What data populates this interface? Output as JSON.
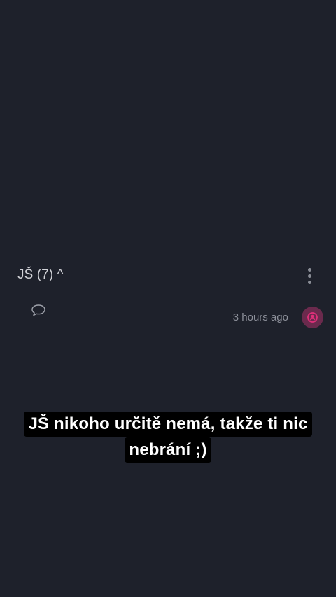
{
  "post": {
    "title": "JŠ (7) ^",
    "timestamp": "3 hours ago",
    "more_icon": "more-vertical-icon",
    "comment_icon": "comment-bubble-icon",
    "avatar_icon": "user-avatar-icon"
  },
  "caption": {
    "lines": [
      "JŠ nikoho určitě nemá, takže ti nic",
      "nebrání ;)"
    ]
  },
  "colors": {
    "background": "#1e212b",
    "avatar": "#6b2a4d",
    "avatar_glyph": "#e0307a"
  }
}
